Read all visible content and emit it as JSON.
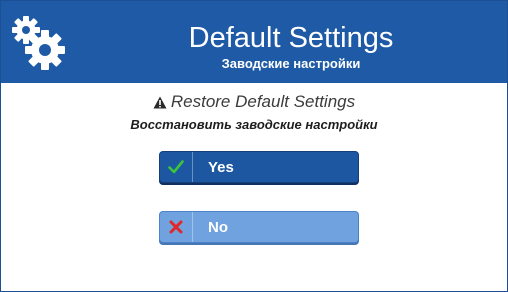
{
  "header": {
    "title": "Default Settings",
    "subtitle": "Заводские настройки",
    "icon": "gears-icon",
    "background": "#1f5aa6"
  },
  "prompt": {
    "icon": "warning-icon",
    "text_en": "Restore Default Settings",
    "text_ru": "Восстановить заводские настройки"
  },
  "buttons": {
    "yes": {
      "label": "Yes",
      "icon": "checkmark-icon",
      "color": "#1d57a2",
      "icon_color": "#3cc43c"
    },
    "no": {
      "label": "No",
      "icon": "cross-icon",
      "color": "#6fa2df",
      "icon_color": "#e02626"
    }
  }
}
